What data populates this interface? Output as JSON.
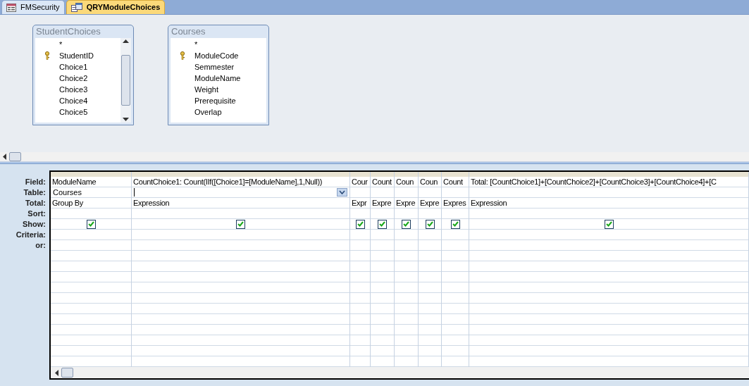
{
  "tabs": [
    {
      "label": "FMSecurity",
      "kind": "form",
      "selected": false
    },
    {
      "label": "QRYModuleChoices",
      "kind": "query",
      "selected": true
    }
  ],
  "tables": [
    {
      "title": "StudentChoices",
      "scrollable": true,
      "fields": [
        {
          "name": "*",
          "primary_key": false
        },
        {
          "name": "StudentID",
          "primary_key": true
        },
        {
          "name": "Choice1",
          "primary_key": false
        },
        {
          "name": "Choice2",
          "primary_key": false
        },
        {
          "name": "Choice3",
          "primary_key": false
        },
        {
          "name": "Choice4",
          "primary_key": false
        },
        {
          "name": "Choice5",
          "primary_key": false
        }
      ]
    },
    {
      "title": "Courses",
      "scrollable": false,
      "fields": [
        {
          "name": "*",
          "primary_key": false
        },
        {
          "name": "ModuleCode",
          "primary_key": true
        },
        {
          "name": "Semmester",
          "primary_key": false
        },
        {
          "name": "ModuleName",
          "primary_key": false
        },
        {
          "name": "Weight",
          "primary_key": false
        },
        {
          "name": "Prerequisite",
          "primary_key": false
        },
        {
          "name": "Overlap",
          "primary_key": false
        }
      ]
    }
  ],
  "row_labels": [
    "Field:",
    "Table:",
    "Total:",
    "Sort:",
    "Show:",
    "Criteria:",
    "or:"
  ],
  "columns": [
    {
      "field": "ModuleName",
      "table": "Courses",
      "total": "Group By",
      "show": true,
      "active": false
    },
    {
      "field": "CountChoice1: Count(IIf([Choice1]=[ModuleName],1,Null))",
      "total": "Expression",
      "show": true,
      "active": true
    },
    {
      "field": "Cour",
      "total": "Expr",
      "show": true,
      "active": false
    },
    {
      "field": "Count",
      "total": "Expre",
      "show": true,
      "active": false
    },
    {
      "field": "Coun",
      "total": "Expre",
      "show": true,
      "active": false
    },
    {
      "field": "Coun",
      "total": "Expre",
      "show": true,
      "active": false
    },
    {
      "field": "Count",
      "total": "Expres",
      "show": true,
      "active": false
    },
    {
      "field": "Total: [CountChoice1]+[CountChoice2]+[CountChoice3]+[CountChoice4]+[C",
      "total": "Expression",
      "show": true,
      "active": false
    }
  ]
}
